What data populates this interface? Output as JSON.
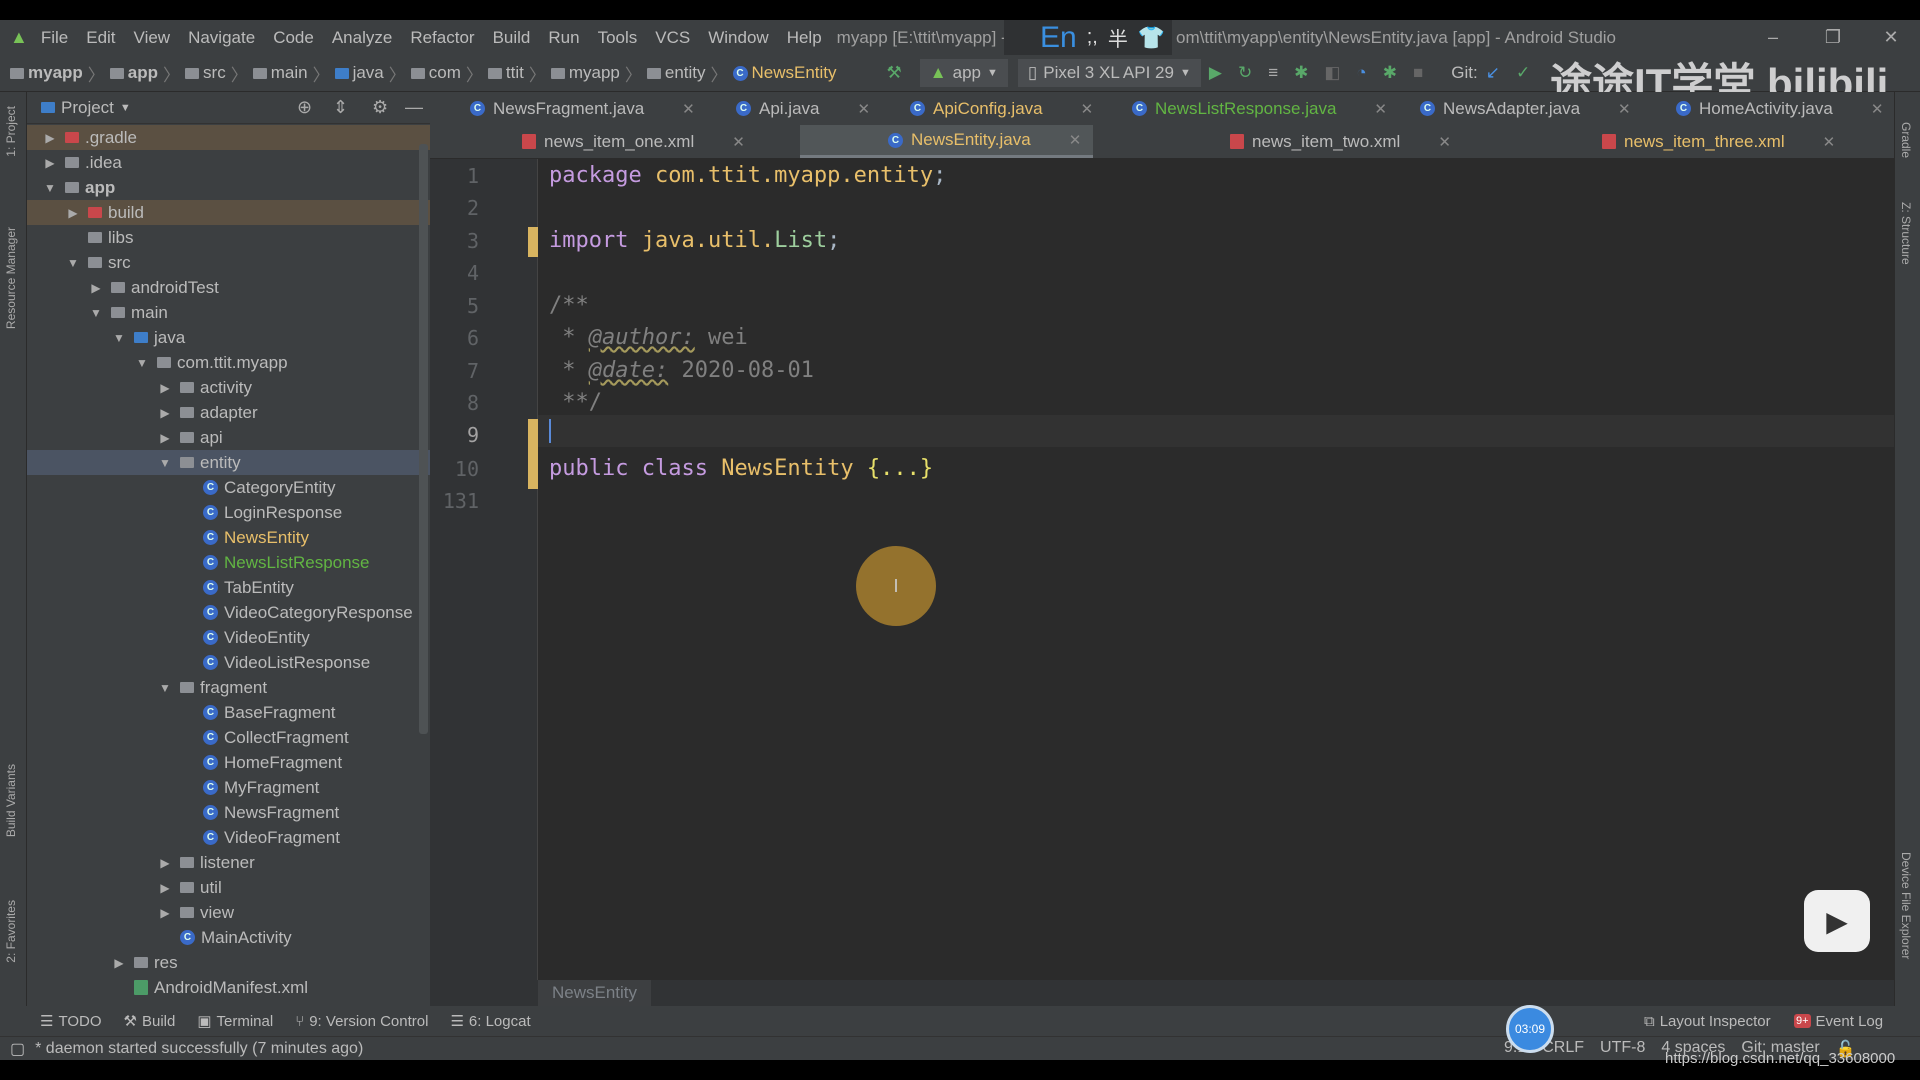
{
  "titlebar": {
    "menus": [
      "File",
      "Edit",
      "View",
      "Navigate",
      "Code",
      "Analyze",
      "Refactor",
      "Build",
      "Run",
      "Tools",
      "VCS",
      "Window",
      "Help"
    ],
    "title_left": "myapp [E:\\ttit\\myapp] - ...\\ap",
    "title_right": "om\\ttit\\myapp\\entity\\NewsEntity.java [app] - Android Studio",
    "ime": "En"
  },
  "navbar": {
    "crumbs": [
      "myapp",
      "app",
      "src",
      "main",
      "java",
      "com",
      "ttit",
      "myapp",
      "entity",
      "NewsEntity"
    ],
    "run_config": "app",
    "device": "Pixel 3 XL API 29",
    "git_label": "Git:"
  },
  "project": {
    "title": "Project",
    "tree": [
      {
        "label": ".gradle",
        "depth": 0,
        "arrow": "right",
        "icon": "folder-red",
        "state": "excluded"
      },
      {
        "label": ".idea",
        "depth": 0,
        "arrow": "right",
        "icon": "folder"
      },
      {
        "label": "app",
        "depth": 0,
        "arrow": "down",
        "icon": "module",
        "bold": true
      },
      {
        "label": "build",
        "depth": 1,
        "arrow": "right",
        "icon": "folder-red",
        "state": "excluded"
      },
      {
        "label": "libs",
        "depth": 1,
        "arrow": "",
        "icon": "folder"
      },
      {
        "label": "src",
        "depth": 1,
        "arrow": "down",
        "icon": "folder"
      },
      {
        "label": "androidTest",
        "depth": 2,
        "arrow": "right",
        "icon": "folder"
      },
      {
        "label": "main",
        "depth": 2,
        "arrow": "down",
        "icon": "folder"
      },
      {
        "label": "java",
        "depth": 3,
        "arrow": "down",
        "icon": "folder-blue"
      },
      {
        "label": "com.ttit.myapp",
        "depth": 4,
        "arrow": "down",
        "icon": "package"
      },
      {
        "label": "activity",
        "depth": 5,
        "arrow": "right",
        "icon": "package"
      },
      {
        "label": "adapter",
        "depth": 5,
        "arrow": "right",
        "icon": "package"
      },
      {
        "label": "api",
        "depth": 5,
        "arrow": "right",
        "icon": "package"
      },
      {
        "label": "entity",
        "depth": 5,
        "arrow": "down",
        "icon": "package",
        "state": "selected"
      },
      {
        "label": "CategoryEntity",
        "depth": 6,
        "icon": "class"
      },
      {
        "label": "LoginResponse",
        "depth": 6,
        "icon": "class"
      },
      {
        "label": "NewsEntity",
        "depth": 6,
        "icon": "class",
        "color": "#e8bf6a"
      },
      {
        "label": "NewsListResponse",
        "depth": 6,
        "icon": "class",
        "color": "#62b543"
      },
      {
        "label": "TabEntity",
        "depth": 6,
        "icon": "class"
      },
      {
        "label": "VideoCategoryResponse",
        "depth": 6,
        "icon": "class"
      },
      {
        "label": "VideoEntity",
        "depth": 6,
        "icon": "class"
      },
      {
        "label": "VideoListResponse",
        "depth": 6,
        "icon": "class"
      },
      {
        "label": "fragment",
        "depth": 5,
        "arrow": "down",
        "icon": "package"
      },
      {
        "label": "BaseFragment",
        "depth": 6,
        "icon": "class"
      },
      {
        "label": "CollectFragment",
        "depth": 6,
        "icon": "class"
      },
      {
        "label": "HomeFragment",
        "depth": 6,
        "icon": "class"
      },
      {
        "label": "MyFragment",
        "depth": 6,
        "icon": "class"
      },
      {
        "label": "NewsFragment",
        "depth": 6,
        "icon": "class"
      },
      {
        "label": "VideoFragment",
        "depth": 6,
        "icon": "class"
      },
      {
        "label": "listener",
        "depth": 5,
        "arrow": "right",
        "icon": "package"
      },
      {
        "label": "util",
        "depth": 5,
        "arrow": "right",
        "icon": "package"
      },
      {
        "label": "view",
        "depth": 5,
        "arrow": "right",
        "icon": "package"
      },
      {
        "label": "MainActivity",
        "depth": 5,
        "icon": "class"
      },
      {
        "label": "res",
        "depth": 3,
        "arrow": "right",
        "icon": "folder"
      },
      {
        "label": "AndroidManifest.xml",
        "depth": 3,
        "icon": "manifest"
      }
    ]
  },
  "tabs_row1": [
    {
      "label": "NewsFragment.java",
      "icon": "class"
    },
    {
      "label": "Api.java",
      "icon": "class"
    },
    {
      "label": "ApiConfig.java",
      "icon": "class",
      "color": "#e8bf6a"
    },
    {
      "label": "NewsListResponse.java",
      "icon": "class",
      "color": "#62b543"
    },
    {
      "label": "NewsAdapter.java",
      "icon": "class"
    },
    {
      "label": "HomeActivity.java",
      "icon": "class"
    }
  ],
  "tabs_row2": [
    {
      "label": "news_item_one.xml",
      "icon": "xml"
    },
    {
      "label": "NewsEntity.java",
      "icon": "class",
      "active": true,
      "color": "#e8bf6a"
    },
    {
      "label": "news_item_two.xml",
      "icon": "xml"
    },
    {
      "label": "news_item_three.xml",
      "icon": "xml",
      "color": "#e8bf6a"
    }
  ],
  "editor": {
    "line_numbers": [
      "1",
      "2",
      "3",
      "4",
      "5",
      "6",
      "7",
      "8",
      "9",
      "10",
      "131"
    ],
    "l1": {
      "kw": "package",
      "pkg": "com.ttit.myapp.entity",
      "end": ";"
    },
    "l3": {
      "kw": "import",
      "pkg": "java.util.",
      "type": "List",
      "end": ";"
    },
    "l5": "/**",
    "l6": {
      "star": " * ",
      "tag": "@author:",
      "val": " wei"
    },
    "l7": {
      "star": " * ",
      "tag": "@date:",
      "val": " 2020-08-01"
    },
    "l8": " **/",
    "l10": {
      "kw": "public class",
      "name": "NewsEntity",
      "folded": "{...}"
    },
    "breadcrumb": "NewsEntity"
  },
  "left_stripe": [
    "1: Project",
    "Resource Manager",
    "Build Variants",
    "2: Favorites"
  ],
  "right_stripe": [
    "Gradle",
    "Z: Structure",
    "Device File Explorer"
  ],
  "toolwindows": [
    "TODO",
    "Build",
    "Terminal",
    "9: Version Control",
    "6: Logcat"
  ],
  "toolwindows_right": [
    "Layout Inspector",
    "Event Log"
  ],
  "event_badge": "9+",
  "status": {
    "message": "* daemon started successfully (7 minutes ago)",
    "position": "9:1",
    "line_sep": "CRLF",
    "encoding": "UTF-8",
    "indent": "4 spaces",
    "git": "Git: master"
  },
  "overlay": {
    "timer": "03:09",
    "watermark": "途途IT学堂 bilibili",
    "url": "https://blog.csdn.net/qq_33608000"
  }
}
